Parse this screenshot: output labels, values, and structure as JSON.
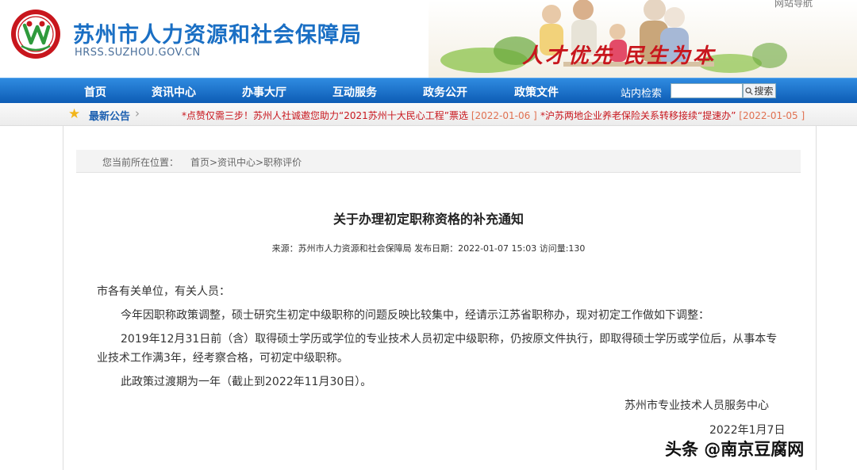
{
  "header": {
    "site_title": "苏州市人力资源和社会保障局",
    "site_url": "HRSS.SUZHOU.GOV.CN",
    "slogan": "人才优先 民生为本",
    "site_nav_link": "网站导航"
  },
  "nav": {
    "items": [
      "首页",
      "资讯中心",
      "办事大厅",
      "互动服务",
      "政务公开",
      "政策文件"
    ],
    "search_label": "站内检索",
    "search_value": "",
    "search_button": "搜索"
  },
  "notice": {
    "title": "最新公告",
    "items": [
      {
        "text": "*点赞仅需三步！苏州人社诚邀您助力“2021苏州十大民心工程”票选",
        "date": "[2022-01-06 ]"
      },
      {
        "text": "*沪苏两地企业养老保险关系转移接续“提速办”",
        "date": "[2022-01-05 ]"
      }
    ]
  },
  "breadcrumb": {
    "label": "您当前所在位置：",
    "path": "首页>资讯中心>职称评价"
  },
  "article": {
    "title": "关于办理初定职称资格的补充通知",
    "meta": "来源：苏州市人力资源和社会保障局  发布日期：2022-01-07 15:03   访问量:130",
    "salutation": "市各有关单位，有关人员：",
    "paragraphs": [
      "今年因职称政策调整，硕士研究生初定中级职称的问题反映比较集中，经请示江苏省职称办，现对初定工作做如下调整：",
      "2019年12月31日前（含）取得硕士学历或学位的专业技术人员初定中级职称，仍按原文件执行，即取得硕士学历或学位后，从事本专业技术工作满3年，经考察合格，可初定中级职称。",
      "此政策过渡期为一年（截止到2022年11月30日）。"
    ],
    "signature": "苏州市专业技术人员服务中心",
    "date": "2022年1月7日"
  },
  "watermark": "头条 @南京豆腐网",
  "colors": {
    "brand_blue": "#1a6fc4",
    "nav_blue": "#0d5cb5",
    "notice_red": "#c8161d",
    "slogan_red": "#c8161d"
  }
}
